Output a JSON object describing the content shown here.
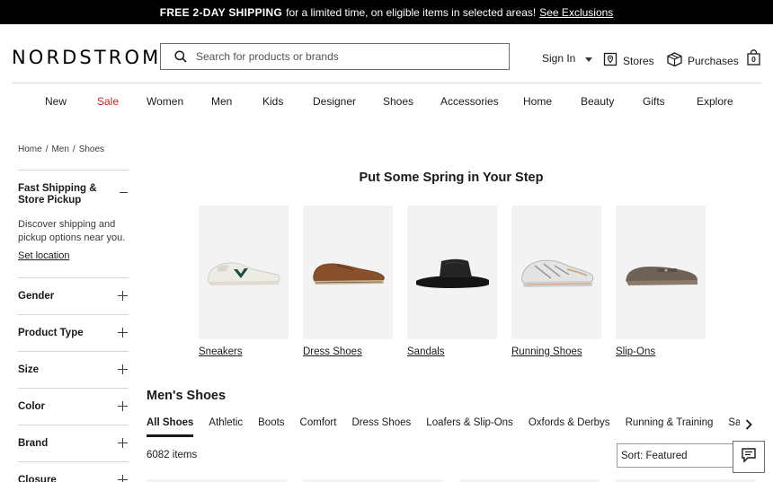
{
  "promo": {
    "bold_text": "FREE 2-DAY SHIPPING",
    "text": "for a limited time, on eligible items in selected areas!",
    "link": "See Exclusions"
  },
  "header": {
    "logo": "NORDSTROM",
    "search_placeholder": "Search for products or brands",
    "sign_in": "Sign In",
    "stores": "Stores",
    "purchases": "Purchases",
    "bag_count": "0"
  },
  "topnav": [
    "New",
    "Sale",
    "Women",
    "Men",
    "Kids",
    "Designer",
    "Shoes",
    "Accessories",
    "Home",
    "Beauty",
    "Gifts",
    "Explore"
  ],
  "breadcrumb": [
    "Home",
    "Men",
    "Shoes"
  ],
  "sidebar": {
    "shipping": {
      "label": "Fast Shipping & Store Pickup",
      "description": "Discover shipping and pickup options near you.",
      "link": "Set location"
    },
    "facets": [
      "Gender",
      "Product Type",
      "Size",
      "Color",
      "Brand",
      "Closure"
    ]
  },
  "hero": {
    "title": "Put Some Spring in Your Step",
    "categories": [
      "Sneakers",
      "Dress Shoes",
      "Sandals",
      "Running Shoes",
      "Slip-Ons"
    ]
  },
  "listing": {
    "title": "Men's Shoes",
    "tabs": [
      "All Shoes",
      "Athletic",
      "Boots",
      "Comfort",
      "Dress Shoes",
      "Loafers & Slip-Ons",
      "Oxfords & Derbys",
      "Running & Training",
      "Sandals & Flip-Flops"
    ],
    "count": "6082 items",
    "sort": "Sort: Featured"
  },
  "colors": {
    "sale": "#c22222",
    "tile_bg": "#f3f3f3",
    "promo_bg": "#000000"
  }
}
